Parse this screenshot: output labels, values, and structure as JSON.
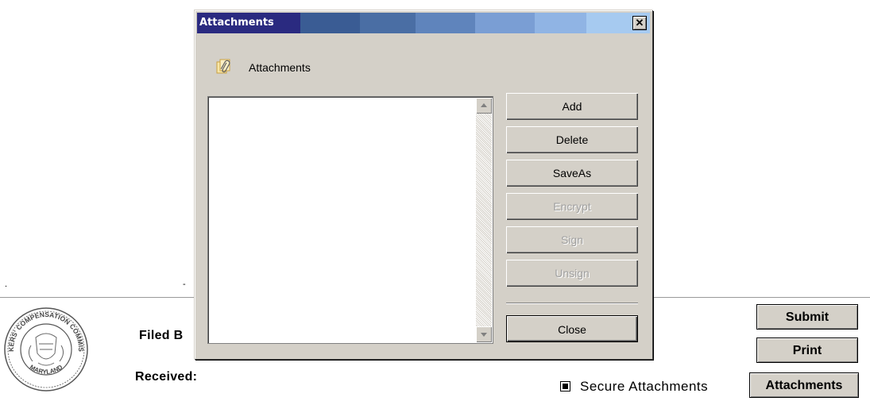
{
  "form": {
    "filed_label": "Filed B",
    "received_label": "Received:",
    "submit_label": "Submit",
    "print_label": "Print",
    "attachments_label": "Attachments",
    "secure_attachments_label": "Secure Attachments",
    "secure_attachments_checked": true,
    "seal": {
      "top_text": "WORKERS' COMPENSATION COMMISSION",
      "bottom_text": "MARYLAND"
    }
  },
  "dialog": {
    "title": "Attachments",
    "close_glyph": "✕",
    "header_label": "Attachments",
    "attachments_list": [],
    "buttons": [
      {
        "label": "Add",
        "enabled": true
      },
      {
        "label": "Delete",
        "enabled": true
      },
      {
        "label": "SaveAs",
        "enabled": true
      },
      {
        "label": "Encrypt",
        "enabled": false
      },
      {
        "label": "Sign",
        "enabled": false
      },
      {
        "label": "Unsign",
        "enabled": false
      }
    ],
    "close_label": "Close"
  },
  "colors": {
    "titlebar_start": "#0a246a",
    "titlebar_end": "#a6caf0",
    "dialog_face": "#d4d0c8",
    "disabled_text": "#a0a0a0"
  },
  "icons": {
    "attachment": "paperclip-attachment-icon",
    "close": "close-icon",
    "scroll_up": "scroll-up-arrow-icon",
    "scroll_down": "scroll-down-arrow-icon",
    "seal": "maryland-wcc-seal-icon"
  }
}
